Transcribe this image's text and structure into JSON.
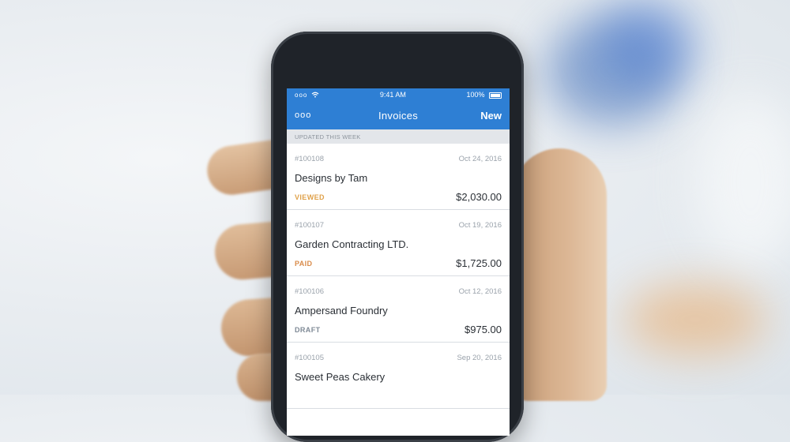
{
  "status_bar": {
    "signal": "ooo",
    "time": "9:41 AM",
    "battery_text": "100%"
  },
  "nav": {
    "menu_label": "ooo",
    "title": "Invoices",
    "new_label": "New"
  },
  "section": {
    "header": "UPDATED THIS WEEK"
  },
  "invoices": [
    {
      "number": "#100108",
      "date": "Oct 24, 2016",
      "client": "Designs by Tam",
      "status": "VIEWED",
      "amount": "$2,030.00",
      "status_color": "#e0a24b"
    },
    {
      "number": "#100107",
      "date": "Oct 19, 2016",
      "client": "Garden Contracting LTD.",
      "status": "PAID",
      "amount": "$1,725.00",
      "status_color": "#d98b4a"
    },
    {
      "number": "#100106",
      "date": "Oct 12, 2016",
      "client": "Ampersand Foundry",
      "status": "DRAFT",
      "amount": "$975.00",
      "status_color": "#7f8a96"
    },
    {
      "number": "#100105",
      "date": "Sep 20, 2016",
      "client": "Sweet Peas Cakery",
      "status": "",
      "amount": "",
      "status_color": "#7f8a96"
    }
  ],
  "colors": {
    "accent": "#2e7fd4",
    "section_bg": "#e3e6ea"
  }
}
